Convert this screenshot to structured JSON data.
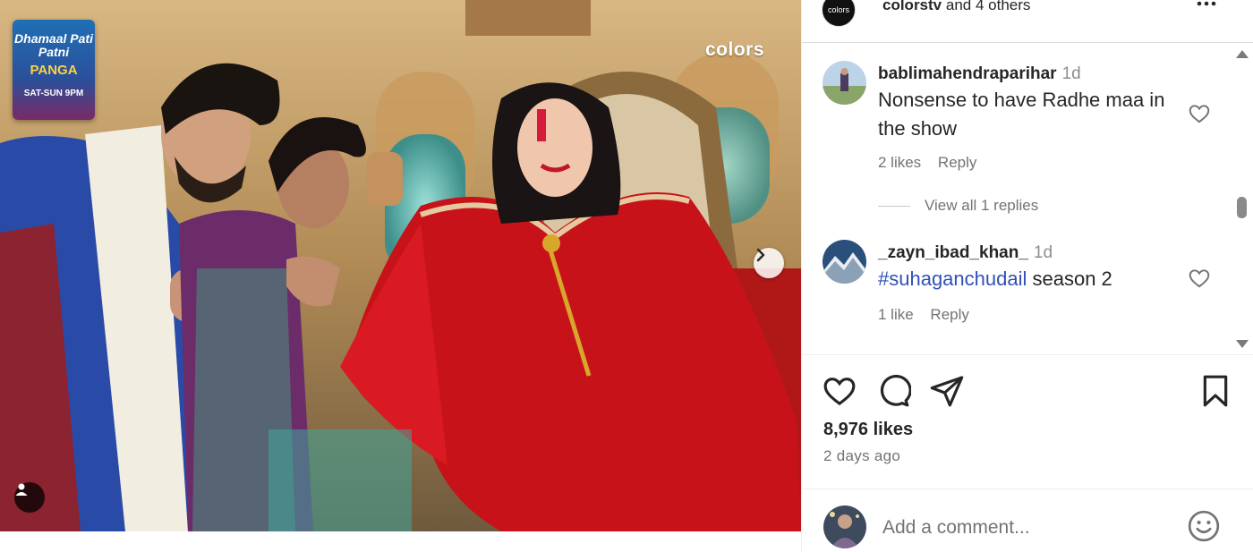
{
  "media": {
    "brand_logo": "colors",
    "show_badge": {
      "line1": "Dhamaal Pati Patni",
      "line2": "PANGA",
      "line3": "SAT-SUN 9PM"
    },
    "next_icon": "chevron-right-icon",
    "tag_icon": "user-icon"
  },
  "header": {
    "avatar_text": "colors",
    "author": "colorstv",
    "coauthors": "and 4 others",
    "more_icon": "more-dots-icon"
  },
  "comments": [
    {
      "username": "bablimahendraparihar",
      "time": "1d",
      "text": "Nonsense to have Radhe maa in the show",
      "likes": "2 likes",
      "reply": "Reply",
      "view_replies": "View all 1 replies"
    },
    {
      "username": "_zayn_ibad_khan_",
      "time": "1d",
      "hashtag": "#suhaganchudail",
      "text_rest": " season 2",
      "likes": "1 like",
      "reply": "Reply"
    }
  ],
  "actions": {
    "like_icon": "heart-icon",
    "comment_icon": "comment-icon",
    "share_icon": "share-icon",
    "save_icon": "bookmark-icon"
  },
  "likes_count": "8,976 likes",
  "posted_time": "2 days ago",
  "add_comment": {
    "placeholder": "Add a comment...",
    "emoji_icon": "emoji-icon"
  },
  "colors": {
    "text": "#262626",
    "secondary": "#737373",
    "hashtag": "#3050b8",
    "border": "#dbdbdb"
  }
}
